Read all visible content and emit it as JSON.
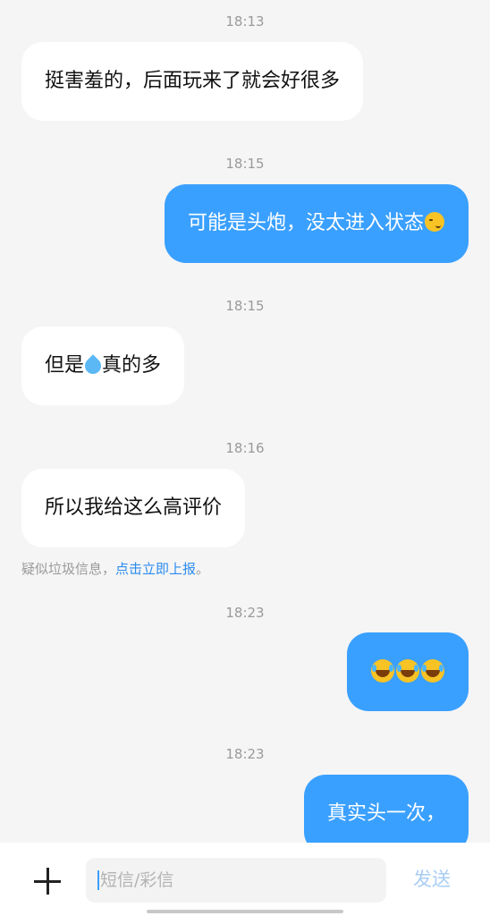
{
  "messages": [
    {
      "time": "18:13",
      "direction": "incoming",
      "text": "挺害羞的，后面玩来了就会好很多"
    },
    {
      "time": "18:15",
      "direction": "outgoing",
      "text": "可能是头炮，没太进入状态",
      "emoji": "smirking-face"
    },
    {
      "time": "18:15",
      "direction": "incoming",
      "text_before": "但是",
      "emoji": "sweat-droplets",
      "text_after": "真的多"
    },
    {
      "time": "18:16",
      "direction": "incoming",
      "text": "所以我给这么高评价"
    },
    {
      "time": "18:23",
      "direction": "outgoing",
      "emoji": "face-with-tears-of-joy",
      "emoji_count": 3
    },
    {
      "time": "18:23",
      "direction": "outgoing",
      "text": "真实头一次，"
    }
  ],
  "spam_notice": {
    "text": "疑似垃圾信息，",
    "link": "点击立即上报",
    "suffix": "。"
  },
  "composer": {
    "placeholder": "短信/彩信",
    "send_label": "发送"
  },
  "colors": {
    "outgoing_bubble": "#3aa0ff",
    "incoming_bubble": "#ffffff",
    "link": "#2b8cf0",
    "send_disabled": "#a8cdf3"
  }
}
